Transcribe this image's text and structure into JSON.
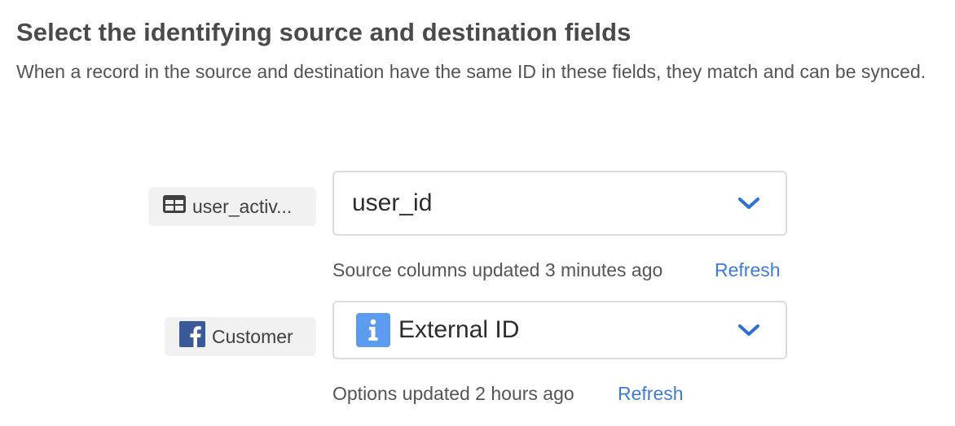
{
  "section": {
    "title": "Select the identifying source and destination fields",
    "description": "When a record in the source and destination have the same ID in these fields, they match and can be synced."
  },
  "source": {
    "label": "user_activ...",
    "icon": "table-icon",
    "selected_value": "user_id",
    "status_text": "Source columns updated 3 minutes ago",
    "refresh_label": "Refresh"
  },
  "destination": {
    "label": "Customer",
    "icon": "facebook-icon",
    "selected_value": "External ID",
    "value_icon": "info-icon",
    "status_text": "Options updated 2 hours ago",
    "refresh_label": "Refresh"
  },
  "colors": {
    "accent": "#3f7ad8",
    "chevron": "#2f6fd6",
    "facebook": "#3b5998",
    "info_badge": "#5b9bf0",
    "chip_background": "#f1f1f1",
    "border": "#dcdcdc"
  }
}
